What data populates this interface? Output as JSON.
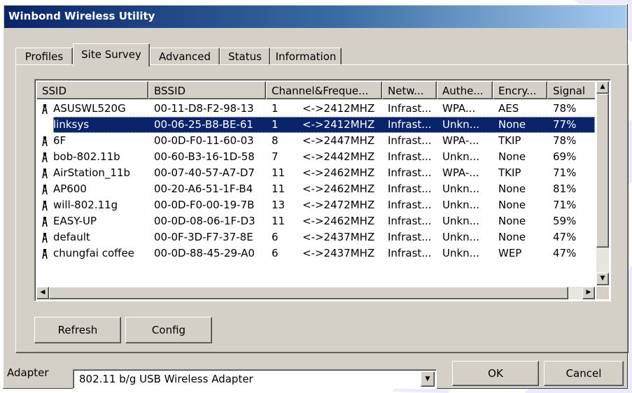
{
  "window": {
    "title": "Winbond Wireless Utility"
  },
  "tabs": [
    {
      "label": "Profiles",
      "active": false
    },
    {
      "label": "Site Survey",
      "active": true
    },
    {
      "label": "Advanced",
      "active": false
    },
    {
      "label": "Status",
      "active": false
    },
    {
      "label": "Information",
      "active": false
    }
  ],
  "table": {
    "columns": [
      "SSID",
      "BSSID",
      "Channel&Freque...",
      "Netw...",
      "Authe...",
      "Encry...",
      "Signal"
    ],
    "selected_index": 1,
    "rows": [
      [
        "ASUSWL520G",
        "00-11-D8-F2-98-13",
        "1",
        "<->2412MHZ",
        "Infrast...",
        "WPA...",
        "AES",
        "78%"
      ],
      [
        "linksys",
        "00-06-25-B8-BE-61",
        "1",
        "<->2412MHZ",
        "Infrast...",
        "Unkn...",
        "None",
        "77%"
      ],
      [
        "6F",
        "00-0D-F0-11-60-03",
        "8",
        "<->2447MHZ",
        "Infrast...",
        "WPA-...",
        "TKIP",
        "78%"
      ],
      [
        "bob-802.11b",
        "00-60-B3-16-1D-58",
        "7",
        "<->2442MHZ",
        "Infrast...",
        "Unkn...",
        "None",
        "69%"
      ],
      [
        "AirStation_11b",
        "00-07-40-57-A7-D7",
        "11",
        "<->2462MHZ",
        "Infrast...",
        "WPA-...",
        "TKIP",
        "71%"
      ],
      [
        "AP600",
        "00-20-A6-51-1F-B4",
        "11",
        "<->2462MHZ",
        "Infrast...",
        "Unkn...",
        "None",
        "81%"
      ],
      [
        "will-802.11g",
        "00-0D-F0-00-19-7B",
        "13",
        "<->2472MHZ",
        "Infrast...",
        "Unkn...",
        "None",
        "71%"
      ],
      [
        "EASY-UP",
        "00-0D-08-06-1F-D3",
        "11",
        "<->2462MHZ",
        "Infrast...",
        "Unkn...",
        "None",
        "59%"
      ],
      [
        "default",
        "00-0F-3D-F7-37-8E",
        "6",
        "<->2437MHZ",
        "Infrast...",
        "Unkn...",
        "None",
        "47%"
      ],
      [
        "chungfai coffee",
        "00-0D-88-45-29-A0",
        "6",
        "<->2437MHZ",
        "Infrast...",
        "Unkn...",
        "WEP",
        "47%"
      ]
    ],
    "row_icon": "signal-tower-icon"
  },
  "buttons": {
    "refresh": "Refresh",
    "config": "Config",
    "ok": "OK",
    "cancel": "Cancel"
  },
  "adapter": {
    "label": "Adapter",
    "value": "802.11 b/g USB Wireless Adapter"
  },
  "scrollbar": {
    "up": "▲",
    "down": "▼",
    "left": "◀",
    "right": "▶",
    "dropdown": "▼"
  },
  "colors": {
    "selection": "#0a246a",
    "face": "#d4d0c8",
    "watermark": "#e8e8ff"
  }
}
